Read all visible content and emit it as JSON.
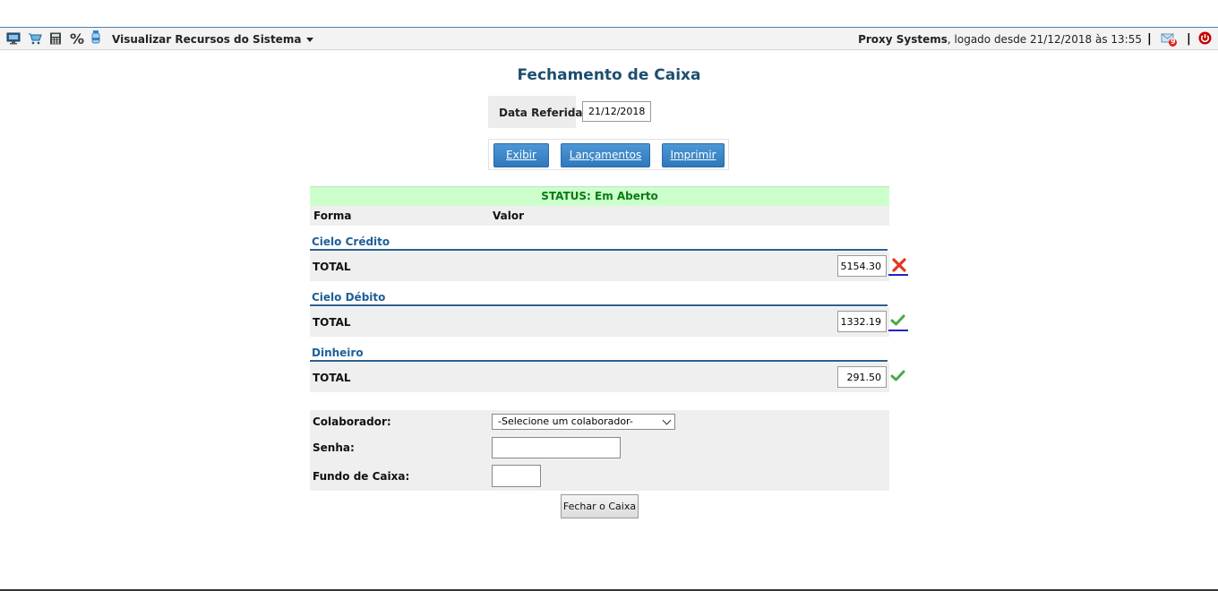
{
  "toolbar": {
    "menu_label": "Visualizar Recursos do Sistema",
    "company": "Proxy Systems",
    "login_text": ", logado desde 21/12/2018 às 13:55",
    "separator": "|",
    "notification_count": "9",
    "icons": [
      "monitor-icon",
      "cart-icon",
      "calculator-icon",
      "percent-icon",
      "water-bottle-icon",
      "notification-icon",
      "power-icon"
    ],
    "percent_glyph": "%"
  },
  "page": {
    "title": "Fechamento de Caixa",
    "date_label": "Data Referida:",
    "date_value": "21/12/2018",
    "buttons": {
      "exibir": "Exibir",
      "lancamentos": "Lançamentos",
      "imprimir": "Imprimir"
    }
  },
  "table": {
    "status": "STATUS: Em Aberto",
    "col_forma": "Forma",
    "col_valor": "Valor",
    "sections": [
      {
        "title": "Cielo Crédito",
        "total_label": "TOTAL",
        "value": "5154.30",
        "status_icon": "delete-icon"
      },
      {
        "title": "Cielo Débito",
        "total_label": "TOTAL",
        "value": "1332.19",
        "status_icon": "check-icon"
      },
      {
        "title": "Dinheiro",
        "total_label": "TOTAL",
        "value": "291.50",
        "status_icon": "check-icon"
      }
    ]
  },
  "form": {
    "colaborador_label": "Colaborador:",
    "colaborador_value": "-Selecione um colaborador-",
    "senha_label": "Senha:",
    "fundo_label": "Fundo de Caixa:",
    "submit_label": "Fechar o Caixa"
  },
  "colors": {
    "title": "#1d4e6e",
    "status_bg": "#ccffcc",
    "status_text": "#0a7a14",
    "section_title": "#1e5f97",
    "button_blue": "#3a86cb"
  }
}
